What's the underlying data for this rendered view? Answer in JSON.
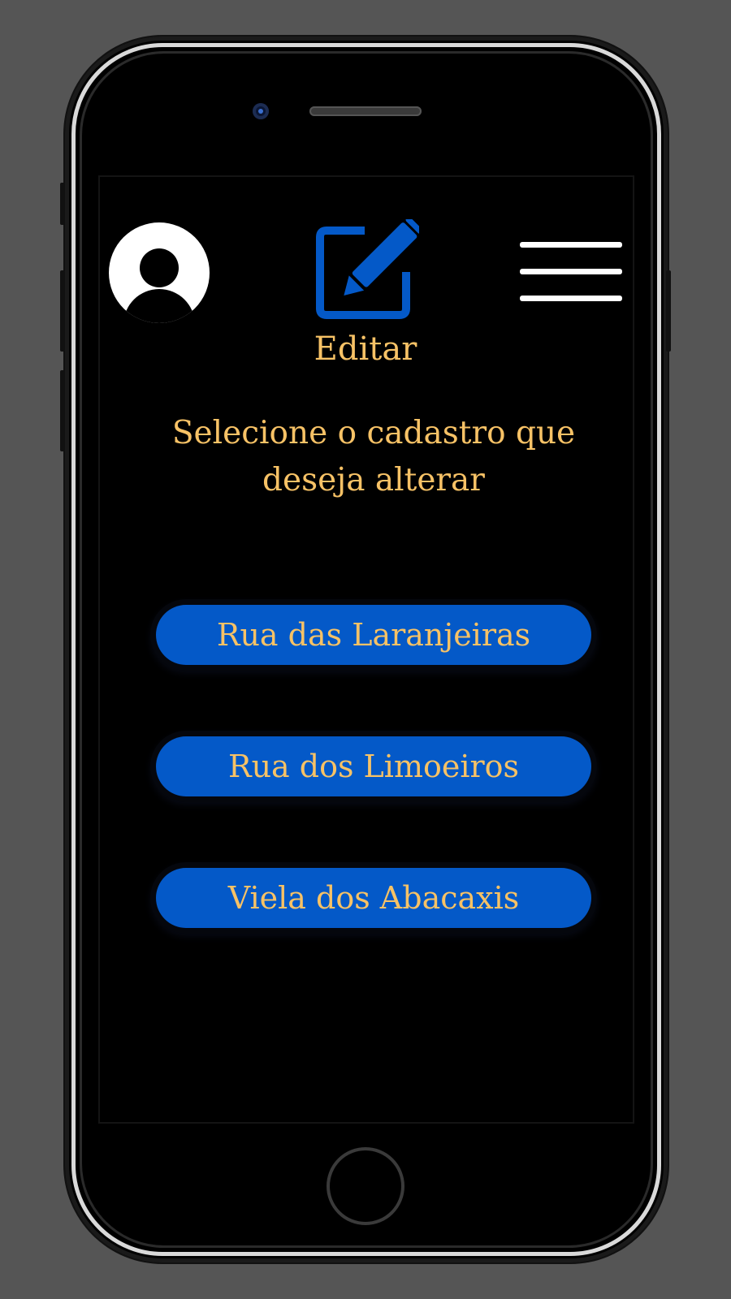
{
  "header": {
    "title": "Editar",
    "avatar_icon": "user-avatar-icon",
    "edit_icon": "edit-pencil-icon",
    "menu_icon": "hamburger-menu-icon"
  },
  "main": {
    "prompt": "Selecione o cadastro que deseja alterar",
    "records": [
      {
        "label": "Rua das Laranjeiras"
      },
      {
        "label": "Rua dos Limoeiros"
      },
      {
        "label": "Viela dos Abacaxis"
      }
    ]
  },
  "colors": {
    "background": "#555555",
    "screen": "#000000",
    "accent_text": "#f7c266",
    "button_fill": "#0459c8"
  }
}
